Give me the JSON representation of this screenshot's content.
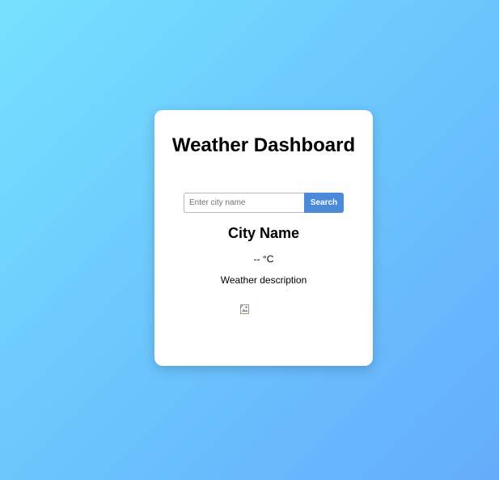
{
  "title": "Weather Dashboard",
  "search": {
    "placeholder": "Enter city name",
    "value": "",
    "button_label": "Search"
  },
  "weather": {
    "city": "City Name",
    "temperature": "-- °C",
    "description": "Weather description",
    "icon": "broken-image-icon"
  },
  "colors": {
    "background_start": "#76e1fe",
    "background_end": "#64acfb",
    "card_background": "#ffffff",
    "button_background": "#4a8ad9",
    "button_text": "#ffffff"
  }
}
